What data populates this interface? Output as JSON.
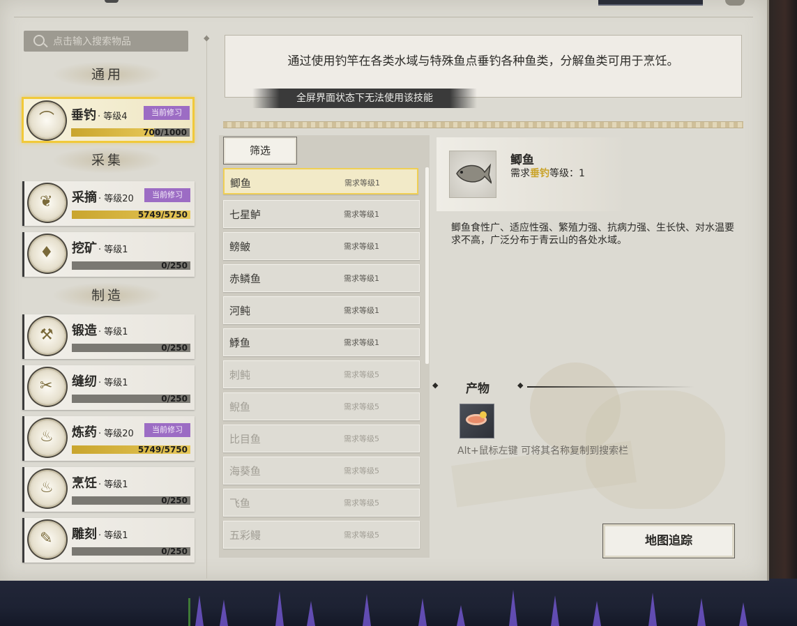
{
  "search": {
    "placeholder": "点击输入搜索物品"
  },
  "categories": [
    {
      "title": "通用"
    },
    {
      "title": "采集"
    },
    {
      "title": "制造"
    }
  ],
  "skills": [
    {
      "name": "垂钓",
      "level": "· 等级4",
      "badge": "当前修习",
      "progress": "700/1000",
      "fill": 0.7,
      "icon": "fishing-rod-icon",
      "glyph": "⌒"
    },
    {
      "name": "采摘",
      "level": "· 等级20",
      "badge": "当前修习",
      "progress": "5749/5750",
      "fill": 1.0,
      "icon": "herb-leaf-icon",
      "glyph": "❦"
    },
    {
      "name": "挖矿",
      "level": "· 等级1",
      "badge": "",
      "progress": "0/250",
      "fill": 0,
      "icon": "ore-crystal-icon",
      "glyph": "♦"
    },
    {
      "name": "锻造",
      "level": "· 等级1",
      "badge": "",
      "progress": "0/250",
      "fill": 0,
      "icon": "anvil-hammer-icon",
      "glyph": "⚒"
    },
    {
      "name": "缝纫",
      "level": "· 等级1",
      "badge": "",
      "progress": "0/250",
      "fill": 0,
      "icon": "thread-spool-icon",
      "glyph": "✂"
    },
    {
      "name": "炼药",
      "level": "· 等级20",
      "badge": "当前修习",
      "progress": "5749/5750",
      "fill": 1.0,
      "icon": "gourd-icon",
      "glyph": "♨"
    },
    {
      "name": "烹饪",
      "level": "· 等级1",
      "badge": "",
      "progress": "0/250",
      "fill": 0,
      "icon": "cooking-pot-icon",
      "glyph": "♨"
    },
    {
      "name": "雕刻",
      "level": "· 等级1",
      "badge": "",
      "progress": "0/250",
      "fill": 0,
      "icon": "carving-knife-icon",
      "glyph": "✎"
    }
  ],
  "description": "通过使用钓竿在各类水域与特殊鱼点垂钓各种鱼类，分解鱼类可用于烹饪。",
  "warning": "全屏界面状态下无法使用该技能",
  "filter_label": "筛选",
  "fish_list": [
    {
      "name": "鲫鱼",
      "req": "需求等级1",
      "dim": false
    },
    {
      "name": "七星鲈",
      "req": "需求等级1",
      "dim": false
    },
    {
      "name": "鳑鲏",
      "req": "需求等级1",
      "dim": false
    },
    {
      "name": "赤鳞鱼",
      "req": "需求等级1",
      "dim": false
    },
    {
      "name": "河鲀",
      "req": "需求等级1",
      "dim": false
    },
    {
      "name": "鯚鱼",
      "req": "需求等级1",
      "dim": false
    },
    {
      "name": "刺鲀",
      "req": "需求等级5",
      "dim": true
    },
    {
      "name": "鲵鱼",
      "req": "需求等级5",
      "dim": true
    },
    {
      "name": "比目鱼",
      "req": "需求等级5",
      "dim": true
    },
    {
      "name": "海葵鱼",
      "req": "需求等级5",
      "dim": true
    },
    {
      "name": "飞鱼",
      "req": "需求等级5",
      "dim": true
    },
    {
      "name": "五彩鳗",
      "req": "需求等级5",
      "dim": true
    }
  ],
  "detail": {
    "name": "鲫鱼",
    "req_prefix": "需求",
    "req_skill": "垂钓",
    "req_suffix": "等级：1",
    "desc": "鲫鱼食性广、适应性强、繁殖力强、抗病力强、生长快、对水温要求不高，广泛分布于青云山的各处水域。",
    "product_title": "产物",
    "hint": "Alt+鼠标左键 可将其名称复制到搜索栏",
    "map_button": "地图追踪"
  },
  "colors": {
    "accent_gold": "#f1c93a",
    "badge_purple": "#9c6cc4",
    "bar_gold": "#d6b443"
  }
}
